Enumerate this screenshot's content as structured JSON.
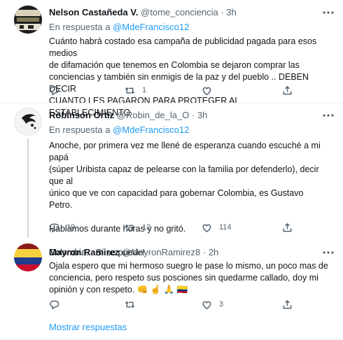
{
  "tweets": [
    {
      "name": "Nelson Castañeda V.",
      "handle": "@tome_conciencia",
      "dot": "·",
      "time": "3h",
      "reply_prefix": "En respuesta a",
      "reply_to": "@MdeFrancisco12",
      "lines": [
        "Cuánto habrá costado esa campaña de publicidad pagada para esos medios",
        "de difamación que tenemos en Colombia se dejaron comprar las",
        "conciencias y también sin enmigis de la paz y del pueblo .. DEBEN DECIR",
        "CUANTO LES PAGARON PARA PROTEGER AL ESTABLECIMIENTO"
      ],
      "counts": {
        "reply": "",
        "retweet": "1",
        "like": ""
      }
    },
    {
      "name": "Robinson Ortiz",
      "handle": "@Robin_de_la_O",
      "dot": "·",
      "time": "3h",
      "reply_prefix": "En respuesta a",
      "reply_to": "@MdeFrancisco12",
      "paragraphs": [
        [
          "Anoche, por primera vez me llené de esperanza cuando escuché a mi papá",
          "(súper Uribista capaz de pelearse con la familia por defenderlo), decir que al",
          "único que ve con capacidad para gobernar Colombia, es Gustavo Petro."
        ],
        [
          "Hablamos durante horas y no gritó."
        ],
        [
          "Colombia... Sí se puede!"
        ]
      ],
      "counts": {
        "reply": "19",
        "retweet": "12",
        "like": "114"
      }
    },
    {
      "name": "Mayron Ramirez",
      "handle": "@MayronRamirez8",
      "dot": "·",
      "time": "2h",
      "lines": [
        "Ojala espero que mi hermoso suegro le pase lo mismo, un poco mas de",
        "conciencia,  pero respeto sus posciones sin quedarme callado, doy mi",
        "opinión y con respeto."
      ],
      "emojis": "👊 ☝ 🙏 🇨🇴",
      "counts": {
        "reply": "",
        "retweet": "",
        "like": "3"
      }
    }
  ],
  "show_replies": "Mostrar respuestas",
  "icons": [
    "more-icon",
    "reply-icon",
    "retweet-icon",
    "like-icon",
    "share-icon"
  ],
  "colors": {
    "link": "#1d9bf0",
    "muted": "#536471",
    "divider": "#eff3f4"
  }
}
